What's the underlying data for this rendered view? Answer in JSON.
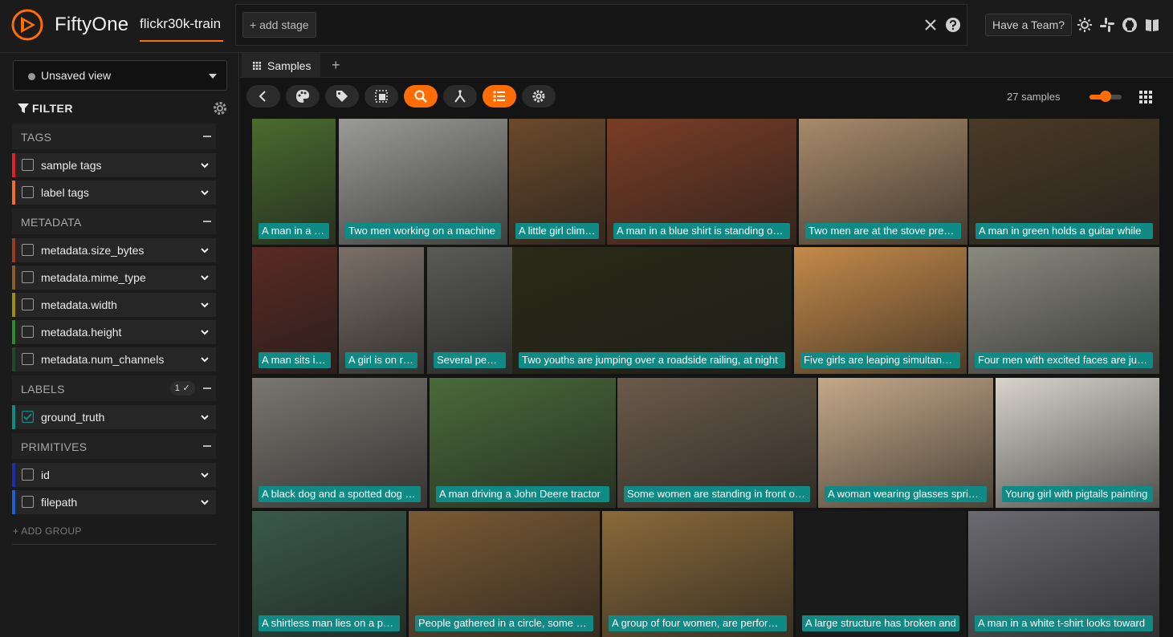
{
  "header": {
    "brand": "FiftyOne",
    "dataset": "flickr30k-train",
    "add_stage": "+ add stage",
    "team_button": "Have a Team?",
    "icons": [
      "close-icon",
      "help-icon",
      "sun-icon",
      "slack-icon",
      "github-icon",
      "book-icon"
    ]
  },
  "sidebar": {
    "view_selector": "Unsaved view",
    "filter_title": "FILTER",
    "groups": {
      "tags": "TAGS",
      "metadata": "METADATA",
      "labels": "LABELS",
      "labels_badge": "1 ✓",
      "primitives": "PRIMITIVES"
    },
    "tags": [
      "sample tags",
      "label tags"
    ],
    "metadata": [
      "metadata.size_bytes",
      "metadata.mime_type",
      "metadata.width",
      "metadata.height",
      "metadata.num_channels"
    ],
    "labels": [
      "ground_truth"
    ],
    "primitives": [
      "id",
      "filepath"
    ],
    "add_group": "+ ADD GROUP",
    "colors": {
      "sample_tags": "#e3202a",
      "label_tags": "#f26b2b",
      "size_bytes": "#9a3b1c",
      "mime_type": "#8b5a2b",
      "width": "#9c8a12",
      "height": "#2f8a2f",
      "num_channels": "#1f4a2a",
      "ground_truth": "#0f8a85",
      "id": "#1a2fb0",
      "filepath": "#1f5fd6"
    }
  },
  "main": {
    "tab_label": "Samples",
    "tab_add": "+",
    "sample_count": "27 samples",
    "zoom_level": 0.5,
    "toolbar_icons": [
      "back-icon",
      "palette-icon",
      "tag-icon",
      "select-icon",
      "search-icon",
      "similarity-icon",
      "list-icon",
      "settings-icon"
    ],
    "accent": "#ff6d04",
    "caption_color": "#0f8a85",
    "samples": [
      {
        "caption": "A man in a blue shirt and...",
        "bg": "#4a6b2f"
      },
      {
        "caption": "Two men working on a machine",
        "bg": "#9a9a98"
      },
      {
        "caption": "A little girl climbing",
        "bg": "#6b4a2b"
      },
      {
        "caption": "A man in a blue shirt is standing on a ladder",
        "bg": "#7a3d26"
      },
      {
        "caption": "Two men are at the stove preparing food",
        "bg": "#a88a6a"
      },
      {
        "caption": "A man in green holds a guitar while",
        "bg": "#4a3a26"
      },
      {
        "caption": "A man sits in a chair",
        "bg": "#5a2a24"
      },
      {
        "caption": "A girl is on roller skates",
        "bg": "#7a7068"
      },
      {
        "caption": "Several people",
        "bg": "#5a5a58"
      },
      {
        "caption": "Two youths are jumping over a roadside railing, at night",
        "bg": "#2a2a18"
      },
      {
        "caption": "Five girls are leaping simultaneously",
        "bg": "#c48a4a"
      },
      {
        "caption": "Four men with excited faces are jumping",
        "bg": "#8a8a80"
      },
      {
        "caption": "A black dog and a spotted dog are fighting",
        "bg": "#7a7670"
      },
      {
        "caption": "A man driving a John Deere tractor",
        "bg": "#4a6a3a"
      },
      {
        "caption": "Some women are standing in front of a bus",
        "bg": "#6a5a4a"
      },
      {
        "caption": "A woman wearing glasses sprinkles",
        "bg": "#c4a888"
      },
      {
        "caption": "Young girl with pigtails painting",
        "bg": "#d8d4cc"
      },
      {
        "caption": "A shirtless man lies on a park bench",
        "bg": "#3a5a4a"
      },
      {
        "caption": "People gathered in a circle, some holding",
        "bg": "#7a5a34"
      },
      {
        "caption": "A group of four women, are performing",
        "bg": "#8a6a3a"
      },
      {
        "caption": "A large structure has broken and",
        "bg": "#1a1a1a"
      },
      {
        "caption": "A man in a white t-shirt looks toward",
        "bg": "#6a6a70"
      }
    ]
  }
}
